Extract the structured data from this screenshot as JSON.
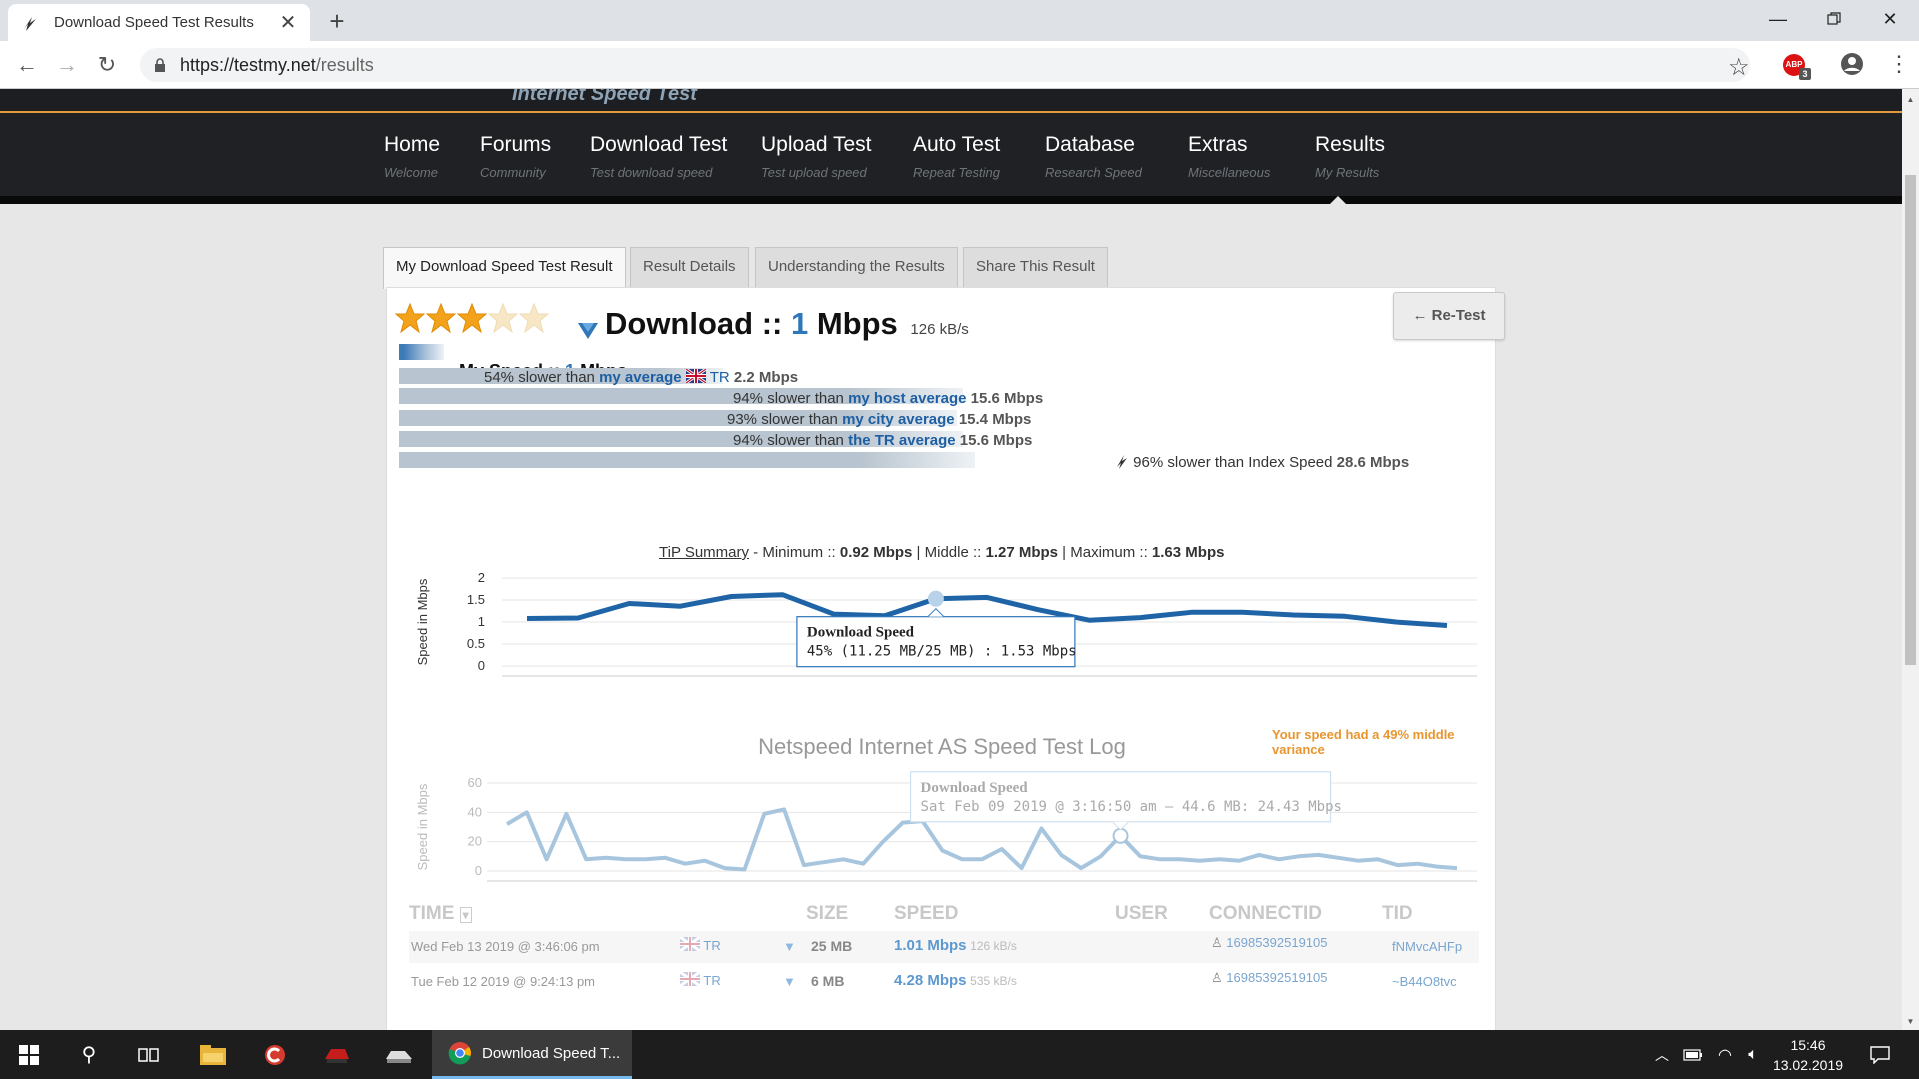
{
  "browser": {
    "tab_title": "Download Speed Test Results",
    "url_host": "https://testmy.net",
    "url_path": "/results"
  },
  "site": {
    "logo_text": "Internet Speed Test",
    "nav": [
      {
        "label": "Home",
        "sub": "Welcome"
      },
      {
        "label": "Forums",
        "sub": "Community"
      },
      {
        "label": "Download Test",
        "sub": "Test download speed"
      },
      {
        "label": "Upload Test",
        "sub": "Test upload speed"
      },
      {
        "label": "Auto Test",
        "sub": "Repeat Testing"
      },
      {
        "label": "Database",
        "sub": "Research Speed"
      },
      {
        "label": "Extras",
        "sub": "Miscellaneous"
      },
      {
        "label": "Results",
        "sub": "My Results"
      }
    ]
  },
  "tabs": [
    "My Download Speed Test Result",
    "Result Details",
    "Understanding the Results",
    "Share This Result"
  ],
  "result": {
    "rating_stars": 3,
    "rating_max": 5,
    "title_prefix": "Download ::",
    "speed_value": "1",
    "speed_unit": "Mbps",
    "kbs": "126 kB/s",
    "retest_label": "← Re-Test",
    "my_speed_prefix": "My Speed ::",
    "my_speed_value": "1",
    "my_speed_unit": "Mbps",
    "comparisons": [
      {
        "pct": "54% slower than",
        "link": "my average",
        "extra": "TR",
        "value": "2.2 Mbps",
        "bar_fraction": 0.54
      },
      {
        "pct": "94% slower than",
        "link": "my host average",
        "value": "15.6 Mbps",
        "bar_fraction": 0.94
      },
      {
        "pct": "93% slower than",
        "link": "my city average",
        "value": "15.4 Mbps",
        "bar_fraction": 0.93
      },
      {
        "pct": "94% slower than",
        "link": "the TR average",
        "value": "15.6 Mbps",
        "bar_fraction": 0.94
      },
      {
        "pct": "96% slower than Index Speed",
        "value": "28.6 Mbps",
        "bar_fraction": 0.96
      }
    ],
    "tip_summary": {
      "label": "TiP Summary",
      "minimum_label": " - Minimum :: ",
      "minimum": "0.92 Mbps",
      "middle_label": " | Middle :: ",
      "middle": "1.27 Mbps",
      "maximum_label": " | Maximum :: ",
      "maximum": "1.63 Mbps"
    },
    "variance_note": "Your speed had a 49% middle variance",
    "log_title": "Netspeed Internet AS Speed Test Log"
  },
  "chart_data": [
    {
      "type": "line",
      "ylabel": "Speed in Mbps",
      "ylim": [
        0,
        2
      ],
      "yticks": [
        "0",
        "0.5",
        "1",
        "1.5",
        "2"
      ],
      "series": [
        {
          "name": "Download Speed",
          "values": [
            1.08,
            1.09,
            1.42,
            1.36,
            1.58,
            1.62,
            1.18,
            1.14,
            1.53,
            1.56,
            1.28,
            1.04,
            1.1,
            1.22,
            1.22,
            1.16,
            1.13,
            1.0,
            0.92
          ]
        }
      ],
      "tooltip": {
        "title": "Download Speed",
        "text": "45% (11.25 MB/25 MB) : 1.53 Mbps"
      },
      "highlight_index": 8,
      "color": "#1f64a6"
    },
    {
      "type": "line",
      "ylabel": "Speed in Mbps",
      "ylim": [
        0,
        60
      ],
      "yticks": [
        "0",
        "20",
        "40",
        "60"
      ],
      "series": [
        {
          "name": "Download Speed",
          "values": [
            32,
            40,
            8,
            39,
            8,
            9,
            8,
            8,
            9,
            5,
            7,
            2,
            1,
            39,
            42,
            4,
            6,
            8,
            5,
            20,
            33,
            34,
            14,
            8,
            8,
            15,
            2,
            29,
            11,
            2,
            10,
            24,
            10,
            8,
            8,
            7,
            8,
            7,
            11,
            8,
            10,
            11,
            9,
            7,
            8,
            4,
            5,
            3,
            2
          ]
        }
      ],
      "tooltip": {
        "title": "Download Speed",
        "text": "Sat Feb 09 2019 @ 3:16:50 am – 44.6 MB: 24.43 Mbps"
      },
      "highlight_index": 31,
      "color": "#a8c5de"
    }
  ],
  "table": {
    "headers": [
      "TIME",
      "SIZE",
      "SPEED",
      "USER",
      "CONNECTID",
      "TID"
    ],
    "rows": [
      {
        "time": "Wed Feb 13 2019 @ 3:46:06 pm",
        "loc": "TR",
        "size": "25 MB",
        "speed": "1.01 Mbps",
        "kbs": "126 kB/s",
        "connectid": "16985392519105",
        "tid": "fNMvcAHFp"
      },
      {
        "time": "Tue Feb 12 2019 @ 9:24:13 pm",
        "loc": "TR",
        "size": "6 MB",
        "speed": "4.28 Mbps",
        "kbs": "535 kB/s",
        "connectid": "16985392519105",
        "tid": "~B44O8tvc"
      }
    ]
  },
  "taskbar": {
    "chrome_label": "Download Speed T...",
    "time": "15:46",
    "date": "13.02.2019"
  }
}
